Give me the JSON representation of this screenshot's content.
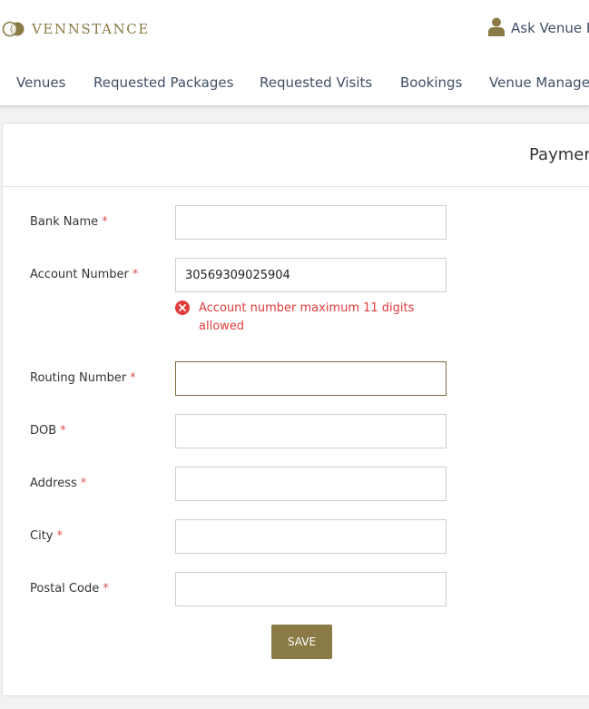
{
  "header": {
    "brand": "VENNSTANCE",
    "ask_label": "Ask Venue E",
    "logo_icon": "venn-circles-logo",
    "user_icon": "user-icon",
    "accent_color": "#8a7a46"
  },
  "nav": {
    "items": [
      {
        "label": "Venues"
      },
      {
        "label": "Requested Packages"
      },
      {
        "label": "Requested Visits"
      },
      {
        "label": "Bookings"
      },
      {
        "label": "Venue Manager"
      }
    ]
  },
  "form": {
    "title": "Paymer",
    "fields": [
      {
        "label": "Bank Name",
        "value": "",
        "required_mark": "*"
      },
      {
        "label": "Account Number",
        "value": "30569309025904",
        "required_mark": "*",
        "error": "Account number maximum 11 digits allowed"
      },
      {
        "label": "Routing Number",
        "value": "",
        "required_mark": "*",
        "focused": true
      },
      {
        "label": "DOB",
        "value": "",
        "required_mark": "*"
      },
      {
        "label": "Address",
        "value": "",
        "required_mark": "*"
      },
      {
        "label": "City",
        "value": "",
        "required_mark": "*"
      },
      {
        "label": "Postal Code",
        "value": "",
        "required_mark": "*"
      }
    ],
    "save_label": "SAVE",
    "error_color": "#e23b3b"
  }
}
